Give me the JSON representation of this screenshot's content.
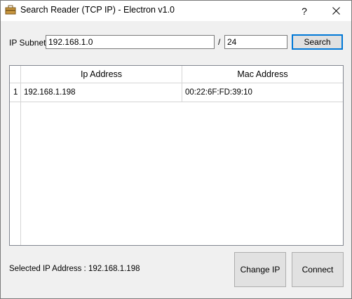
{
  "window": {
    "title": "Search Reader (TCP IP) - Electron v1.0",
    "help_label": "?",
    "app_icon": "toolbox-icon",
    "close_icon": "close-icon"
  },
  "subnet": {
    "label": "IP Subnet",
    "ip_value": "192.168.1.0",
    "separator": "/",
    "mask_value": "24",
    "search_label": "Search"
  },
  "grid": {
    "columns": [
      "Ip Address",
      "Mac Address"
    ],
    "rows": [
      {
        "num": "1",
        "ip": "192.168.1.198",
        "mac": "00:22:6F:FD:39:10"
      }
    ]
  },
  "footer": {
    "selected_text": "Selected IP Address :  192.168.1.198",
    "change_ip_label": "Change IP",
    "connect_label": "Connect"
  }
}
